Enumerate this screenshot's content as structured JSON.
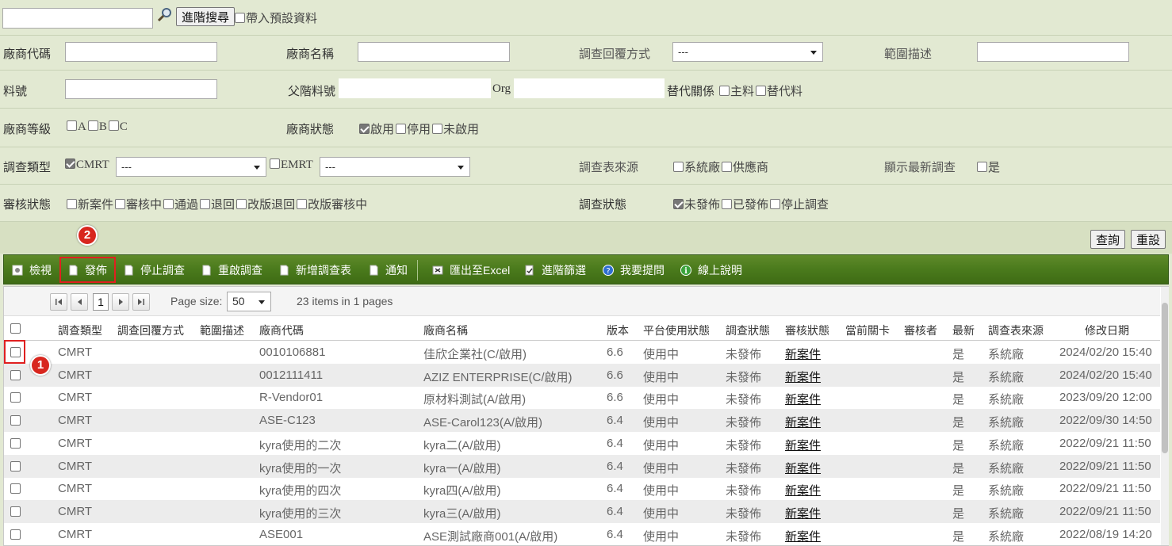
{
  "search": {
    "value": "",
    "advanced_button": "進階搜尋",
    "default_data_label": "帶入預設資料"
  },
  "filters": {
    "vendor_code": "廠商代碼",
    "vendor_name": "廠商名稱",
    "reply_method": "調查回覆方式",
    "reply_method_value": "---",
    "scope": "範圍描述",
    "part_no": "料號",
    "parent_part_no": "父階料號",
    "org": "Org",
    "alt_relation": "替代關係",
    "alt_options": [
      "主料",
      "替代料"
    ],
    "vendor_grade": "廠商等級",
    "grade_options": [
      "A",
      "B",
      "C"
    ],
    "vendor_status": "廠商狀態",
    "vendor_status_options": [
      "啟用",
      "停用",
      "未啟用"
    ],
    "survey_type": "調查類型",
    "cmrt": "CMRT",
    "cmrt_select": "---",
    "emrt": "EMRT",
    "emrt_select": "---",
    "survey_source": "調查表來源",
    "source_options": [
      "系統廠",
      "供應商"
    ],
    "show_latest": "顯示最新調查",
    "show_latest_option": "是",
    "review_status": "審核狀態",
    "review_options": [
      "新案件",
      "審核中",
      "通過",
      "退回",
      "改版退回",
      "改版審核中"
    ],
    "survey_status": "調查狀態",
    "survey_status_options": [
      "未發佈",
      "已發佈",
      "停止調查"
    ]
  },
  "actions": {
    "query": "查詢",
    "reset": "重設"
  },
  "toolbar": [
    "檢視",
    "發佈",
    "停止調查",
    "重啟調查",
    "新增調查表",
    "通知",
    "匯出至Excel",
    "進階篩選",
    "我要提問",
    "線上說明"
  ],
  "markers": [
    "1",
    "2"
  ],
  "pager": {
    "page": "1",
    "page_size_label": "Page size:",
    "page_size": "50",
    "summary": "23 items in 1 pages"
  },
  "columns": [
    "調查類型",
    "調查回覆方式",
    "範圍描述",
    "廠商代碼",
    "廠商名稱",
    "版本",
    "平台使用狀態",
    "調查狀態",
    "審核狀態",
    "當前關卡",
    "審核者",
    "最新",
    "調查表來源",
    "修改日期"
  ],
  "rows": [
    {
      "type": "CMRT",
      "code": "0010106881",
      "name": "佳欣企業社(C/啟用)",
      "ver": "6.6",
      "platform": "使用中",
      "status": "未發佈",
      "review": "新案件",
      "latest": "是",
      "source": "系統廠",
      "date": "2024/02/20 15:40"
    },
    {
      "type": "CMRT",
      "code": "0012111411",
      "name": "AZIZ ENTERPRISE(C/啟用)",
      "ver": "6.6",
      "platform": "使用中",
      "status": "未發佈",
      "review": "新案件",
      "latest": "是",
      "source": "系統廠",
      "date": "2024/02/20 15:40"
    },
    {
      "type": "CMRT",
      "code": "R-Vendor01",
      "name": "原材料測試(A/啟用)",
      "ver": "6.6",
      "platform": "使用中",
      "status": "未發佈",
      "review": "新案件",
      "latest": "是",
      "source": "系統廠",
      "date": "2023/09/20 12:00"
    },
    {
      "type": "CMRT",
      "code": "ASE-C123",
      "name": "ASE-Carol123(A/啟用)",
      "ver": "6.4",
      "platform": "使用中",
      "status": "未發佈",
      "review": "新案件",
      "latest": "是",
      "source": "系統廠",
      "date": "2022/09/30 14:50"
    },
    {
      "type": "CMRT",
      "code": "kyra使用的二次",
      "name": "kyra二(A/啟用)",
      "ver": "6.4",
      "platform": "使用中",
      "status": "未發佈",
      "review": "新案件",
      "latest": "是",
      "source": "系統廠",
      "date": "2022/09/21 11:50"
    },
    {
      "type": "CMRT",
      "code": "kyra使用的一次",
      "name": "kyra一(A/啟用)",
      "ver": "6.4",
      "platform": "使用中",
      "status": "未發佈",
      "review": "新案件",
      "latest": "是",
      "source": "系統廠",
      "date": "2022/09/21 11:50"
    },
    {
      "type": "CMRT",
      "code": "kyra使用的四次",
      "name": "kyra四(A/啟用)",
      "ver": "6.4",
      "platform": "使用中",
      "status": "未發佈",
      "review": "新案件",
      "latest": "是",
      "source": "系統廠",
      "date": "2022/09/21 11:50"
    },
    {
      "type": "CMRT",
      "code": "kyra使用的三次",
      "name": "kyra三(A/啟用)",
      "ver": "6.4",
      "platform": "使用中",
      "status": "未發佈",
      "review": "新案件",
      "latest": "是",
      "source": "系統廠",
      "date": "2022/09/21 11:50"
    },
    {
      "type": "CMRT",
      "code": "ASE001",
      "name": "ASE測試廠商001(A/啟用)",
      "ver": "6.4",
      "platform": "使用中",
      "status": "未發佈",
      "review": "新案件",
      "latest": "是",
      "source": "系統廠",
      "date": "2022/08/19 14:20"
    }
  ]
}
